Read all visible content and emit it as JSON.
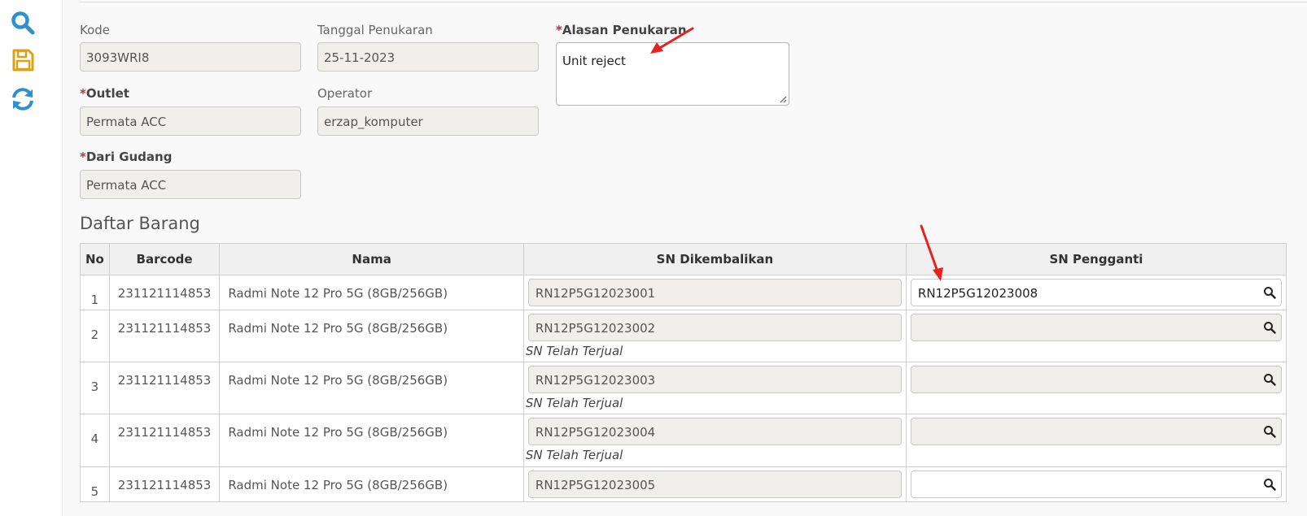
{
  "toolbar": {
    "search_icon": "search-icon",
    "save_icon": "floppy-disk-icon",
    "refresh_icon": "refresh-icon",
    "search_color": "#2e90cf",
    "save_color": "#d9a21b",
    "refresh_color": "#2e90cf"
  },
  "form": {
    "kode": {
      "label": "Kode",
      "value": "3093WRI8"
    },
    "tanggal": {
      "label": "Tanggal Penukaran",
      "value": "25-11-2023"
    },
    "alasan": {
      "star": "*",
      "label": "Alasan Penukaran",
      "value": "Unit reject"
    },
    "outlet": {
      "star": "*",
      "label": "Outlet",
      "value": "Permata ACC"
    },
    "operator": {
      "label": "Operator",
      "value": "erzap_komputer"
    },
    "gudang": {
      "star": "*",
      "label": "Dari Gudang",
      "value": "Permata ACC"
    }
  },
  "section_title": "Daftar Barang",
  "table": {
    "headers": [
      "No",
      "Barcode",
      "Nama",
      "SN Dikembalikan",
      "SN Pengganti"
    ],
    "rows": [
      {
        "no": "1",
        "barcode": "231121114853",
        "nama": "Radmi Note 12 Pro 5G (8GB/256GB)",
        "sn": "RN12P5G12023001",
        "note": "",
        "replacement": "RN12P5G12023008"
      },
      {
        "no": "2",
        "barcode": "231121114853",
        "nama": "Radmi Note 12 Pro 5G (8GB/256GB)",
        "sn": "RN12P5G12023002",
        "note": "SN Telah Terjual",
        "replacement": ""
      },
      {
        "no": "3",
        "barcode": "231121114853",
        "nama": "Radmi Note 12 Pro 5G (8GB/256GB)",
        "sn": "RN12P5G12023003",
        "note": "SN Telah Terjual",
        "replacement": ""
      },
      {
        "no": "4",
        "barcode": "231121114853",
        "nama": "Radmi Note 12 Pro 5G (8GB/256GB)",
        "sn": "RN12P5G12023004",
        "note": "SN Telah Terjual",
        "replacement": ""
      },
      {
        "no": "5",
        "barcode": "231121114853",
        "nama": "Radmi Note 12 Pro 5G (8GB/256GB)",
        "sn": "RN12P5G12023005",
        "note": "",
        "replacement": ""
      }
    ]
  },
  "annotation_color": "#e8211c"
}
